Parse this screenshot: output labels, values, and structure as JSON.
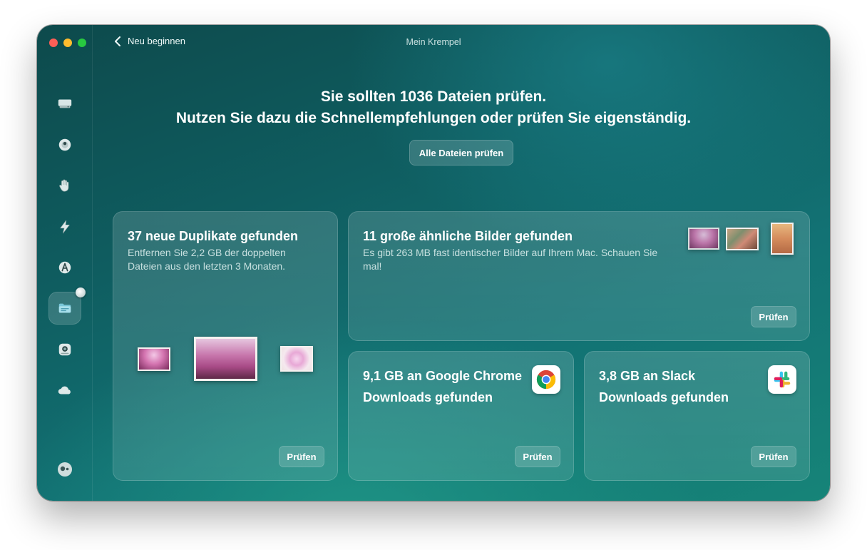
{
  "window": {
    "title": "Mein Krempel",
    "back_label": "Neu beginnen"
  },
  "sidebar": {
    "items": [
      {
        "icon": "disk-icon"
      },
      {
        "icon": "shield-icon"
      },
      {
        "icon": "hand-icon"
      },
      {
        "icon": "bolt-icon"
      },
      {
        "icon": "apps-icon"
      },
      {
        "icon": "folder-icon",
        "active": true
      },
      {
        "icon": "scanner-icon"
      },
      {
        "icon": "cloud-icon"
      }
    ],
    "bottom_icon": "assistant-icon"
  },
  "headline": {
    "line1": "Sie sollten 1036 Dateien prüfen.",
    "line2": "Nutzen Sie dazu die Schnellempfehlungen oder prüfen Sie eigenständig."
  },
  "primary_button": "Alle Dateien prüfen",
  "cards": {
    "duplicates": {
      "title": "37 neue Duplikate gefunden",
      "description": "Entfernen Sie 2,2 GB der doppelten Dateien aus den letzten 3 Monaten.",
      "button": "Prüfen"
    },
    "similar_images": {
      "title": "11 große ähnliche Bilder gefunden",
      "description": "Es gibt 263 MB fast identischer Bilder auf Ihrem Mac. Schauen Sie mal!",
      "button": "Prüfen"
    },
    "chrome": {
      "title": "9,1 GB an Google Chrome Downloads gefunden",
      "icon": "chrome-icon",
      "button": "Prüfen"
    },
    "slack": {
      "title": "3,8 GB an Slack Downloads gefunden",
      "icon": "slack-icon",
      "button": "Prüfen"
    }
  },
  "colors": {
    "background_start": "#0d4a4c",
    "background_end": "#168478",
    "traffic_red": "#fe5f57",
    "traffic_yellow": "#febc2e",
    "traffic_green": "#28c840"
  }
}
